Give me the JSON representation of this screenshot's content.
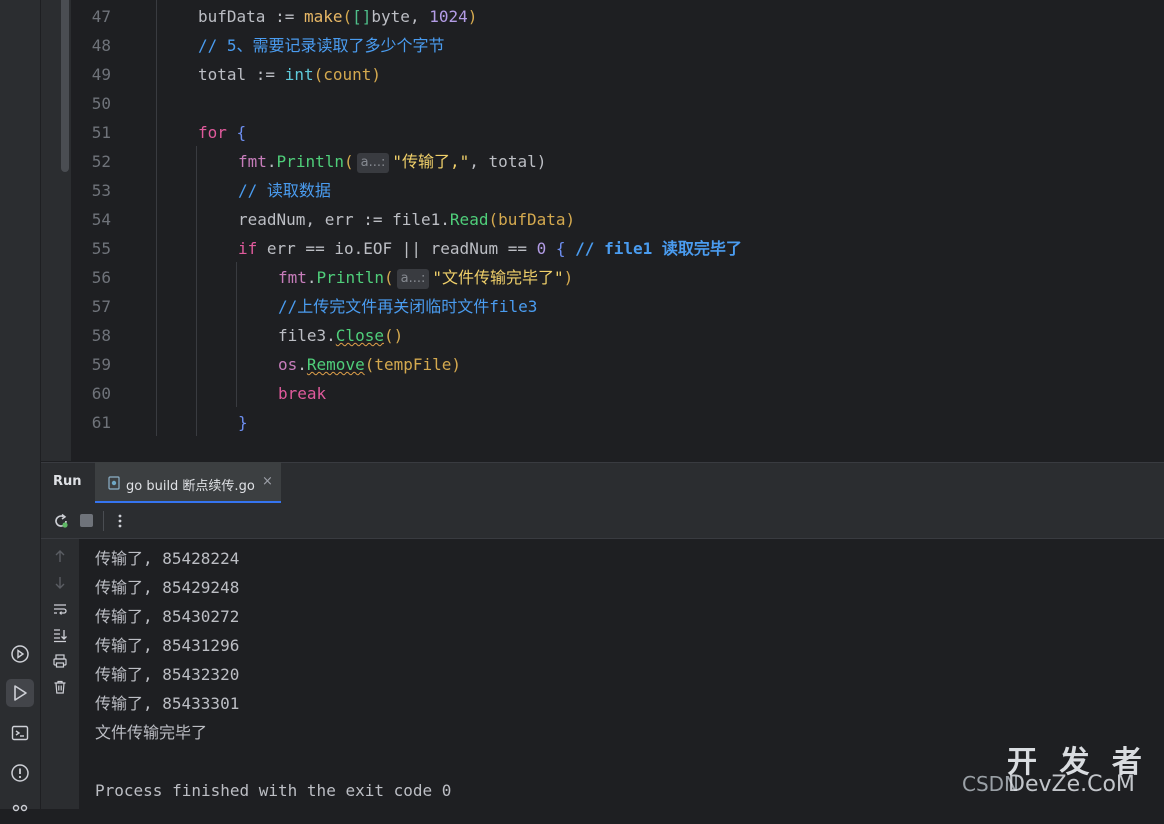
{
  "editor": {
    "lines": [
      {
        "num": "47"
      },
      {
        "num": "48"
      },
      {
        "num": "49"
      },
      {
        "num": "50"
      },
      {
        "num": "51"
      },
      {
        "num": "52"
      },
      {
        "num": "53"
      },
      {
        "num": "54"
      },
      {
        "num": "55"
      },
      {
        "num": "56"
      },
      {
        "num": "57"
      },
      {
        "num": "58"
      },
      {
        "num": "59"
      },
      {
        "num": "60"
      },
      {
        "num": "61"
      }
    ],
    "code": {
      "l47_a": "bufData := ",
      "l47_b": "make",
      "l47_c": "(",
      "l47_d": "[]",
      "l47_e": "byte, ",
      "l47_f": "1024",
      "l47_g": ")",
      "l48": "// 5、需要记录读取了多少个字节",
      "l49_a": "total := ",
      "l49_b": "int",
      "l49_c": "(count)",
      "l51_a": "for",
      "l51_b": " {",
      "l52_a": "fmt",
      "l52_b": ".",
      "l52_c": "Println",
      "l52_d": "(",
      "l52_hint": "a...:",
      "l52_e": "\"传输了,\"",
      "l52_f": ", total)",
      "l53": "// 读取数据",
      "l54_a": "readNum, err := file1.",
      "l54_b": "Read",
      "l54_c": "(bufData)",
      "l55_a": "if",
      "l55_b": " err == io.EOF || readNum == ",
      "l55_c": "0",
      "l55_d": " { ",
      "l55_e": "// file1 读取完毕了",
      "l56_a": "fmt",
      "l56_b": ".",
      "l56_c": "Println",
      "l56_d": "(",
      "l56_hint": "a...:",
      "l56_e": "\"文件传输完毕了\"",
      "l56_f": ")",
      "l57": "//上传完文件再关闭临时文件file3",
      "l58_a": "file3.",
      "l58_b": "Close",
      "l58_c": "()",
      "l59_a": "os",
      "l59_b": ".",
      "l59_c": "Remove",
      "l59_d": "(tempFile)",
      "l60": "break",
      "l61": "}"
    }
  },
  "run_panel": {
    "title": "Run",
    "tab_label": "go build 断点续传.go",
    "tab_close": "×",
    "output": [
      "传输了, 85428224",
      "传输了, 85429248",
      "传输了, 85430272",
      "传输了, 85431296",
      "传输了, 85432320",
      "传输了, 85433301",
      "文件传输完毕了",
      "",
      "Process finished with the exit code 0"
    ]
  },
  "watermark": {
    "prefix": "CSDN",
    "cn": "开 发 者",
    "suffix": "DevZe.CoM"
  },
  "icons": {
    "stripe": [
      "services-icon",
      "run-icon",
      "terminal-icon",
      "problems-icon",
      "git-icon"
    ],
    "toolbar": [
      "rerun-icon",
      "stop-icon",
      "more-options-icon"
    ],
    "side": [
      "scroll-up-icon",
      "scroll-down-icon",
      "soft-wrap-icon",
      "scroll-to-end-icon",
      "print-icon",
      "clear-all-icon"
    ]
  }
}
